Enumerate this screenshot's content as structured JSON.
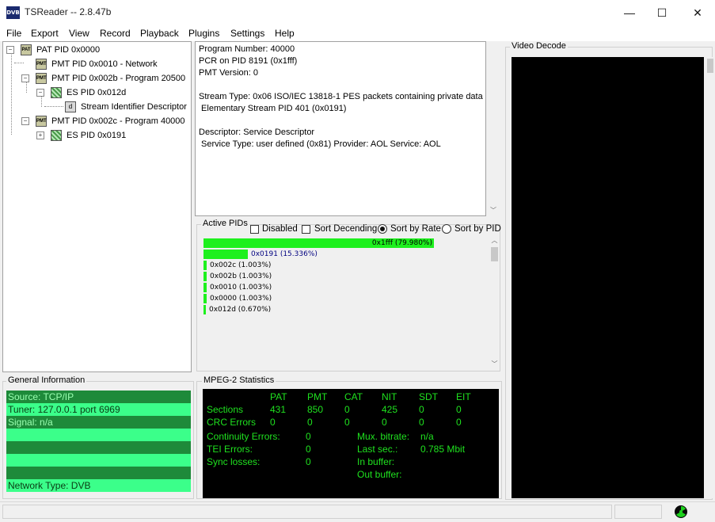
{
  "app": {
    "title": "TSReader -- 2.8.47b",
    "logo_text": "DVB"
  },
  "window_controls": {
    "minimize": "—",
    "maximize": "☐",
    "close": "✕"
  },
  "menu": [
    "File",
    "Export",
    "View",
    "Record",
    "Playback",
    "Plugins",
    "Settings",
    "Help"
  ],
  "tree": {
    "pat": "PAT PID 0x0000",
    "pmt_network": "PMT PID 0x0010 - Network",
    "pmt_20500": "PMT PID 0x002b - Program 20500",
    "es_012d": "ES PID 0x012d",
    "stream_identifier": "Stream Identifier Descriptor",
    "pmt_40000": "PMT PID 0x002c - Program 40000",
    "es_0191": "ES PID 0x0191",
    "icon_pat": "PAT",
    "icon_pmt": "PMT",
    "icon_desc": "d"
  },
  "info": {
    "lines": [
      "Program Number: 40000",
      "PCR on PID 8191 (0x1fff)",
      "PMT Version: 0",
      "",
      "Stream Type: 0x06 ISO/IEC 13818-1 PES packets containing private data",
      " Elementary Stream PID 401 (0x0191)",
      "",
      "Descriptor: Service Descriptor",
      " Service Type: user defined (0x81) Provider: AOL Service: AOL"
    ]
  },
  "active_pids": {
    "label": "Active PIDs",
    "disabled_label": "Disabled",
    "sort_descending_label": "Sort Decending",
    "sort_by_rate_label": "Sort by Rate",
    "sort_by_pid_label": "Sort by PID",
    "disabled": false,
    "sort_descending": false,
    "sort_mode": "rate",
    "bar_color": "#1ef01e",
    "pids": [
      {
        "label": "0x1fff (79.980%)",
        "fraction": 0.7998
      },
      {
        "label": "0x0191 (15.336%)",
        "fraction": 0.15336
      },
      {
        "label": "0x002c (1.003%)",
        "fraction": 0.01003
      },
      {
        "label": "0x002b (1.003%)",
        "fraction": 0.01003
      },
      {
        "label": "0x0010 (1.003%)",
        "fraction": 0.01003
      },
      {
        "label": "0x0000 (1.003%)",
        "fraction": 0.01003
      },
      {
        "label": "0x012d (0.670%)",
        "fraction": 0.0067
      }
    ]
  },
  "video_decode": {
    "label": "Video Decode"
  },
  "general_info": {
    "label": "General Information",
    "source": "Source: TCP/IP",
    "tuner": "Tuner: 127.0.0.1 port 6969",
    "signal": "Signal: n/a",
    "network_type": "Network Type: DVB"
  },
  "mpeg2": {
    "label": "MPEG-2 Statistics",
    "headers": [
      "PAT",
      "PMT",
      "CAT",
      "NIT",
      "SDT",
      "EIT"
    ],
    "sections_label": "Sections",
    "sections": [
      "431",
      "850",
      "0",
      "425",
      "0",
      "0"
    ],
    "crc_label": "CRC Errors",
    "crc": [
      "0",
      "0",
      "0",
      "0",
      "0",
      "0"
    ],
    "continuity_label": "Continuity Errors:",
    "continuity": "0",
    "tei_label": "TEI Errors:",
    "tei": "0",
    "sync_label": "Sync losses:",
    "sync": "0",
    "mux_label": "Mux. bitrate:",
    "mux": "n/a",
    "last_sec_label": "Last sec.:",
    "last_sec": "0.785 Mbit",
    "in_buffer_label": "In buffer:",
    "out_buffer_label": "Out buffer:",
    "text_color": "#1fe21f"
  }
}
